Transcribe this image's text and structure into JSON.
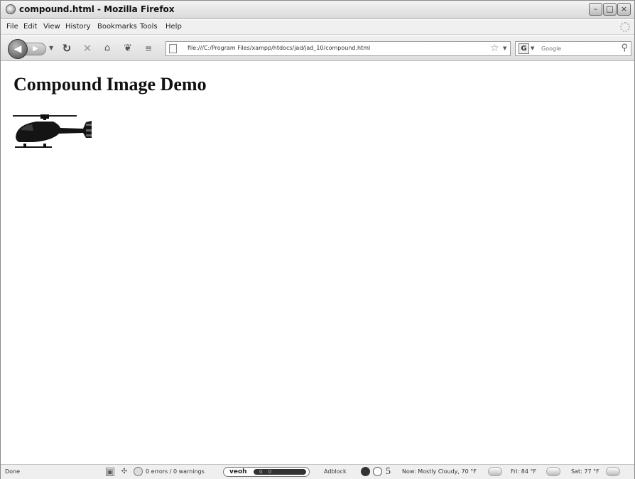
{
  "window": {
    "title": "compound.html - Mozilla Firefox"
  },
  "menu": {
    "items": [
      "File",
      "Edit",
      "View",
      "History",
      "Bookmarks",
      "Tools",
      "Help"
    ]
  },
  "navbar": {
    "url": "file:///C:/Program Files/xampp/htdocs/jad/jad_10/compound.html",
    "search_placeholder": "Google",
    "search_engine_icon": "G"
  },
  "page": {
    "heading": "Compound Image Demo",
    "image_label": "helicopter"
  },
  "status": {
    "state": "Done",
    "errors": "0 errors / 0 warnings",
    "veoh_label": "veoh",
    "veoh_counts": "0  0",
    "adblock": "Adblock",
    "count": "5",
    "weather_now": "Now: Mostly Cloudy, 70 °F",
    "weather_fri": "Fri: 84 °F",
    "weather_sat": "Sat: 77 °F"
  },
  "icons": {
    "back": "back-arrow-icon",
    "forward": "forward-arrow-icon",
    "reload": "reload-icon",
    "stop": "stop-icon",
    "home": "home-icon",
    "bookmark_star": "star-icon",
    "search": "magnifier-icon"
  }
}
